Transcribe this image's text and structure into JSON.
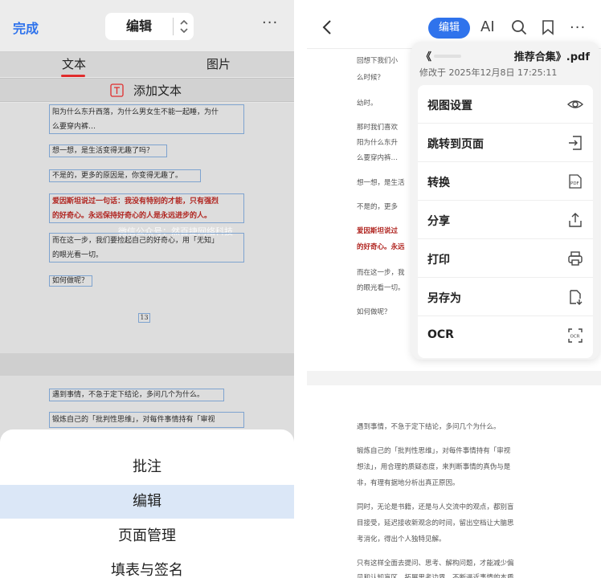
{
  "left": {
    "done_label": "完成",
    "mode_label": "编辑",
    "more": "···",
    "tabs": [
      {
        "label": "文本"
      },
      {
        "label": "图片"
      }
    ],
    "add_text_label": "添加文本",
    "text_boxes": [
      "阳为什么东升西落，为什么男女生不能一起睡，为什",
      "么要穿内裤…",
      "想一想，是生活变得无趣了吗？",
      "不是的，更多的原因是，你变得无趣了。",
      "爱因斯坦说过一句话：我没有特别的才能，只有强烈",
      "的好奇心。永远保持好奇心的人是永远进步的人。",
      "而在这一步，我们要捡起自己的好奇心，用「无知」",
      "的眼光看一切。",
      "如何做呢？"
    ],
    "page_number": "13",
    "watermark": "微信公众号：然百捷网络科技",
    "page2_boxes": [
      "遇到事情，不急于定下结论，多问几个为什么。",
      "锻炼自己的「批判性思维」，对每件事情持有「审视"
    ],
    "sheet_items": [
      "批注",
      "编辑",
      "页面管理",
      "填表与签名"
    ]
  },
  "right": {
    "edit_label": "编辑",
    "ai_label": "AI",
    "more": "···",
    "doc_lines_top": [
      "回想下我们小",
      "么时候？",
      "幼时。",
      "那时我们喜欢",
      "阳为什么东升",
      "么要穿内裤…",
      "想一想，是生活",
      "不是的，更多",
      "爱因斯坦说过",
      "的好奇心。永远",
      "而在这一步，我",
      "的眼光看一切。",
      "如何做呢？"
    ],
    "doc_lines_bottom": [
      "遇到事情，不急于定下结论，多问几个为什么。",
      "锻炼自己的「批判性思维」，对每件事情持有「审视",
      "想法」，用合理的质疑态度，来判断事情的真伪与是",
      "非，有理有据地分析出真正原因。",
      "同时，无论是书籍，还是与人交流中的观点，都别盲",
      "目接受，延迟接收新观念的时间，留出空档让大脑思",
      "考消化，得出个人独特见解。",
      "只有这样全面去提问、思考、解构问题，才能减少偏",
      "见和认知盲区，拓展思考边界，不断逼近事情的本质"
    ],
    "menu": {
      "title_prefix": "《",
      "file_name": "推荐合集》.pdf",
      "modified": "修改于 2025年12月8日 17:25:11",
      "items": [
        {
          "label": "视图设置",
          "icon": "eye-icon"
        },
        {
          "label": "跳转到页面",
          "icon": "jump-to-page-icon"
        },
        {
          "label": "转换",
          "icon": "pdf-convert-icon"
        },
        {
          "label": "分享",
          "icon": "share-icon"
        },
        {
          "label": "打印",
          "icon": "printer-icon"
        },
        {
          "label": "另存为",
          "icon": "save-as-icon"
        },
        {
          "label": "OCR",
          "icon": "ocr-icon"
        }
      ]
    }
  },
  "colors": {
    "accent": "#2f73ec",
    "tab_underline": "#e02d2d",
    "highlight_red": "#b0241f",
    "selected_sheet_item": "#dbe7f7"
  }
}
